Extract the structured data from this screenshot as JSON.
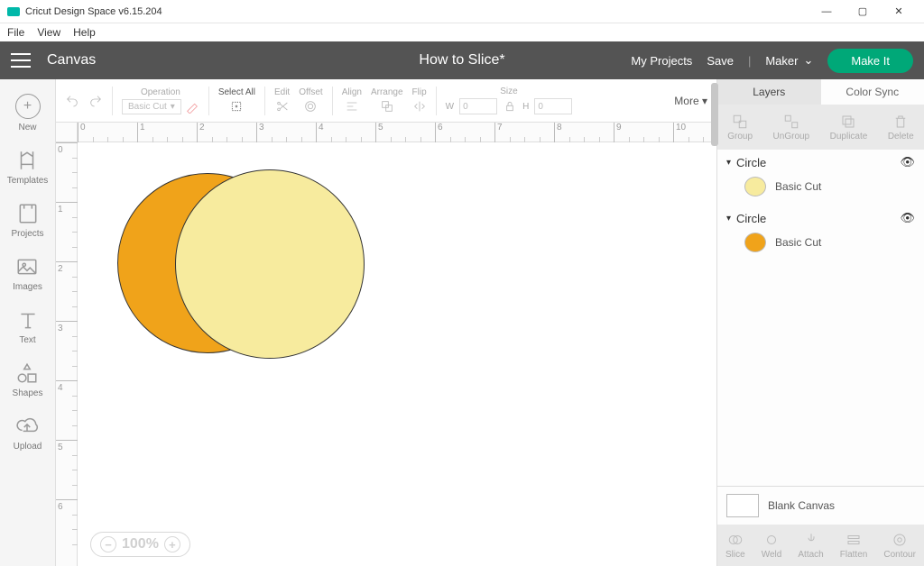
{
  "window": {
    "title": "Cricut Design Space  v6.15.204"
  },
  "menubar": {
    "file": "File",
    "view": "View",
    "help": "Help"
  },
  "topbar": {
    "canvas_label": "Canvas",
    "project_title": "How to Slice*",
    "my_projects": "My Projects",
    "save": "Save",
    "machine": "Maker",
    "make_it": "Make It"
  },
  "leftnav": {
    "new": "New",
    "templates": "Templates",
    "projects": "Projects",
    "images": "Images",
    "text": "Text",
    "shapes": "Shapes",
    "upload": "Upload"
  },
  "toolbar": {
    "operation_label": "Operation",
    "operation_value": "Basic Cut",
    "select_all": "Select All",
    "edit": "Edit",
    "offset": "Offset",
    "align": "Align",
    "arrange": "Arrange",
    "flip": "Flip",
    "size": "Size",
    "w": "W",
    "h": "H",
    "w_val": "0",
    "h_val": "0",
    "more": "More"
  },
  "zoom": {
    "value": "100%"
  },
  "rightpanel": {
    "tabs": {
      "layers": "Layers",
      "color_sync": "Color Sync"
    },
    "actions": {
      "group": "Group",
      "ungroup": "UnGroup",
      "duplicate": "Duplicate",
      "delete": "Delete"
    },
    "layers": [
      {
        "name": "Circle",
        "op": "Basic Cut",
        "color": "#f7eb9e"
      },
      {
        "name": "Circle",
        "op": "Basic Cut",
        "color": "#f0a31a"
      }
    ],
    "blank_canvas": "Blank Canvas",
    "bottom": {
      "slice": "Slice",
      "weld": "Weld",
      "attach": "Attach",
      "flatten": "Flatten",
      "contour": "Contour"
    }
  },
  "ruler": {
    "majors_h": [
      "0",
      "1",
      "2",
      "3",
      "4",
      "5",
      "6",
      "7",
      "8",
      "9",
      "10"
    ],
    "majors_v": [
      "0",
      "1",
      "2",
      "3",
      "4",
      "5",
      "6"
    ]
  },
  "canvas_shapes": [
    {
      "type": "circle",
      "fill": "#f0a31a"
    },
    {
      "type": "circle",
      "fill": "#f7eb9e"
    }
  ]
}
